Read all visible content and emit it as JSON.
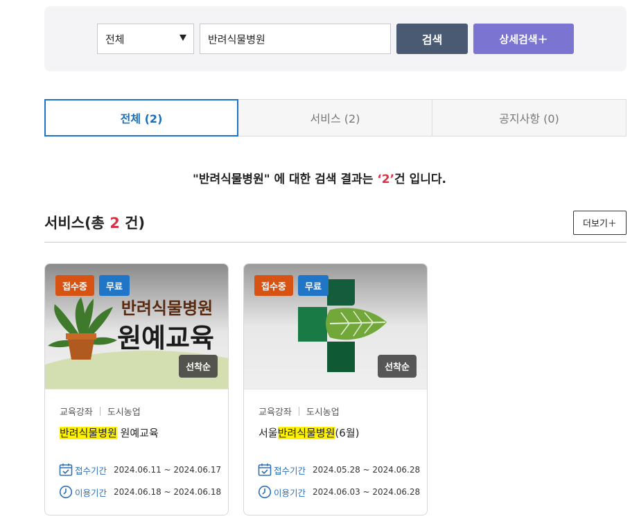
{
  "search": {
    "category_selected": "전체",
    "query": "반려식물병원",
    "search_label": "검색",
    "advanced_label": "상세검색＋"
  },
  "tabs": [
    {
      "label": "전체 (2)"
    },
    {
      "label": "서비스 (2)"
    },
    {
      "label": "공지사항 (0)"
    }
  ],
  "result": {
    "prefix": "\"반려식물병원\" 에 대한 검색 결과는 ",
    "count": "‘2’",
    "suffix": "건 입니다."
  },
  "section": {
    "prefix": "서비스(총 ",
    "count": "2",
    "suffix": " 건)",
    "more_label": "더보기＋"
  },
  "cards": [
    {
      "status": "접수중",
      "fee": "무료",
      "order": "선착순",
      "thumb_line1": "반려식물병원",
      "thumb_line2": "원예교육",
      "category1": "교육강좌",
      "category2": "도시농업",
      "title_pre": "",
      "title_hl": "반려식물병원",
      "title_post": " 원예교육",
      "apply_label": "접수기간",
      "apply_period": "2024.06.11 ~ 2024.06.17",
      "use_label": "이용기간",
      "use_period": "2024.06.18 ~ 2024.06.18"
    },
    {
      "status": "접수중",
      "fee": "무료",
      "order": "선착순",
      "category1": "교육강좌",
      "category2": "도시농업",
      "title_pre": "서울",
      "title_hl": "반려식물병원",
      "title_post": "(6월)",
      "apply_label": "접수기간",
      "apply_period": "2024.05.28 ~ 2024.06.28",
      "use_label": "이용기간",
      "use_period": "2024.06.03 ~ 2024.06.28"
    }
  ],
  "colors": {
    "accent_blue": "#1a73c8",
    "highlight": "#fff200",
    "count_red": "#d6334b",
    "status_orange": "#d65314",
    "fee_blue": "#2175c6"
  }
}
